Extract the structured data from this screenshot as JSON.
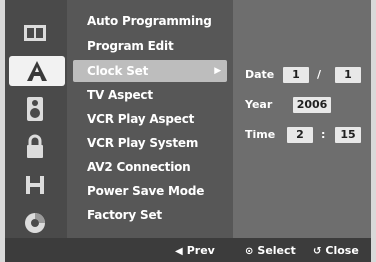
{
  "sidebar": {
    "icons": [
      "film-icon",
      "letter-a-icon",
      "speaker-icon",
      "lock-icon",
      "film-strip-icon",
      "disc-icon"
    ],
    "active_index": 1
  },
  "menu": {
    "items": [
      {
        "label": "Auto Programming"
      },
      {
        "label": "Program Edit"
      },
      {
        "label": "Clock Set",
        "selected": true
      },
      {
        "label": "TV Aspect"
      },
      {
        "label": "VCR Play Aspect"
      },
      {
        "label": "VCR Play System"
      },
      {
        "label": "AV2 Connection"
      },
      {
        "label": "Power Save Mode"
      },
      {
        "label": "Factory Set"
      }
    ],
    "selected_arrow": "▶"
  },
  "clock": {
    "date_label": "Date",
    "date_month": "1",
    "date_separator": "/",
    "date_day": "1",
    "year_label": "Year",
    "year_value": "2006",
    "time_label": "Time",
    "time_hour": "2",
    "time_separator": ":",
    "time_minute": "15"
  },
  "footer": {
    "prev_glyph": "◀",
    "prev_label": "Prev",
    "select_glyph": "⊙",
    "select_label": "Select",
    "close_glyph": "↺",
    "close_label": "Close"
  }
}
